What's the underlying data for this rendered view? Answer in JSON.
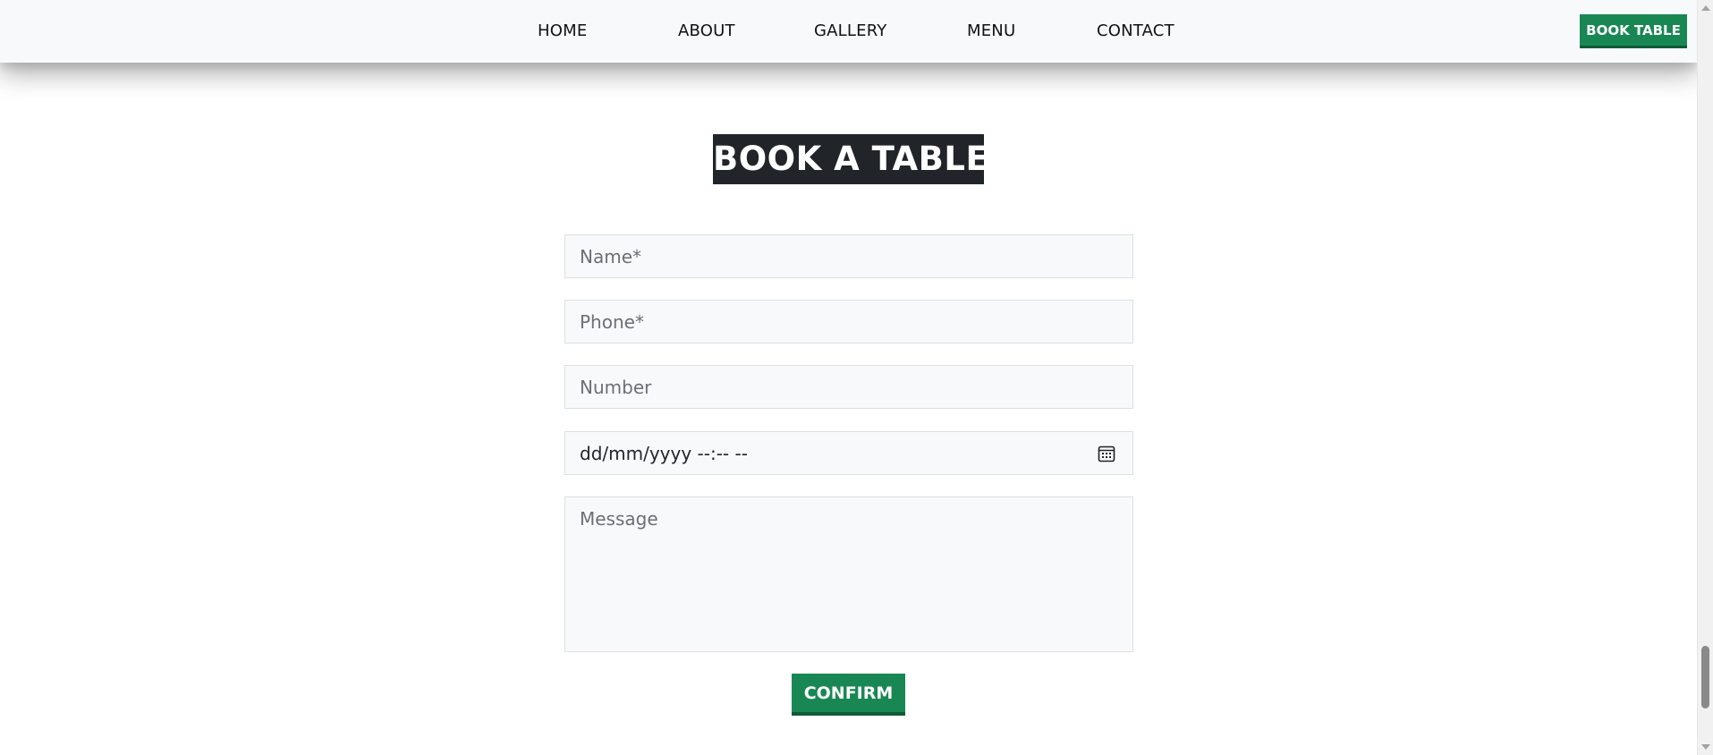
{
  "nav": {
    "links": [
      "HOME",
      "ABOUT",
      "GALLERY",
      "MENU",
      "CONTACT"
    ],
    "book_button": "BOOK TABLE"
  },
  "section": {
    "title": "BOOK A TABLE"
  },
  "form": {
    "name_placeholder": "Name*",
    "phone_placeholder": "Phone*",
    "number_placeholder": "Number",
    "datetime_display": "dd/mm/yyyy --:-- --",
    "datetime_icon": "calendar-icon",
    "message_placeholder": "Message",
    "confirm_label": "CONFIRM"
  },
  "colors": {
    "accent": "#198754",
    "heading_bg": "#212529",
    "field_bg": "#f8f9fa",
    "navbar_bg": "#f8f9fa"
  }
}
